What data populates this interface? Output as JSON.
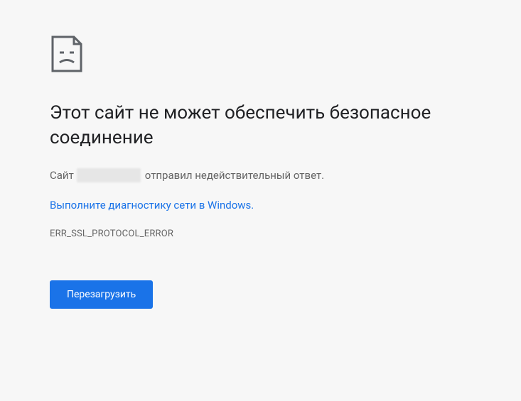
{
  "heading": "Этот сайт не может обеспечить безопасное соединение",
  "subtext_prefix": "Сайт",
  "subtext_suffix": "отправил недействительный ответ.",
  "diagnostic_link": "Выполните диагностику сети в Windows.",
  "error_code": "ERR_SSL_PROTOCOL_ERROR",
  "reload_button": "Перезагрузить"
}
